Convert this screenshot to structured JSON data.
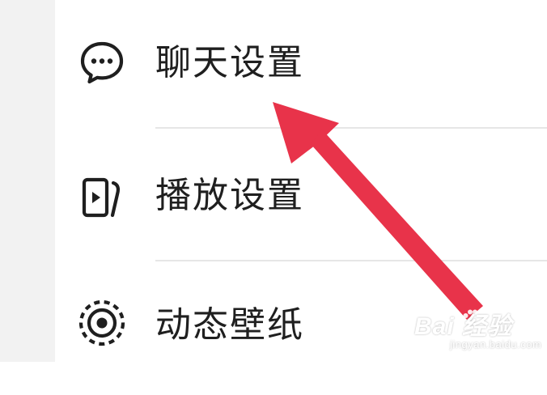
{
  "menu": {
    "items": [
      {
        "label": "聊天设置",
        "icon": "chat-bubble-icon"
      },
      {
        "label": "播放设置",
        "icon": "playback-icon"
      },
      {
        "label": "动态壁纸",
        "icon": "live-wallpaper-icon"
      }
    ]
  },
  "annotation": {
    "arrow_color": "#e8334a"
  },
  "watermark": {
    "brand": "Bai  经验",
    "site": "jingyan.baidu.com"
  },
  "colors": {
    "text": "#1f1f1f",
    "divider": "#e6e6e6",
    "left_strip": "#f2f2f2",
    "background": "#ffffff"
  }
}
